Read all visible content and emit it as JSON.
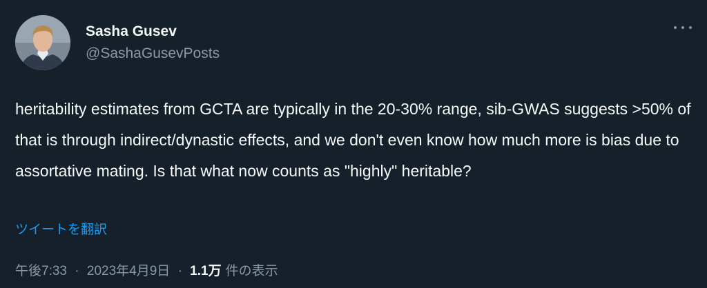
{
  "author": {
    "name": "Sasha Gusev",
    "handle": "@SashaGusevPosts"
  },
  "tweet": {
    "text": "heritability estimates from GCTA are typically in the 20-30% range, sib-GWAS suggests >50% of that is through indirect/dynastic effects, and we don't even know how much more is bias due to assortative mating. Is that what now counts as \"highly\" heritable?",
    "translate_label": "ツイートを翻訳"
  },
  "meta": {
    "time": "午後7:33",
    "date": "2023年4月9日",
    "separator": "·",
    "views_count": "1.1万",
    "views_label": "件の表示"
  },
  "icons": {
    "more": "more-horizontal-icon",
    "avatar": "profile-photo"
  },
  "colors": {
    "background": "#15202b",
    "primary_text": "#f7f9f9",
    "secondary_text": "#8b98a5",
    "link": "#1d9bf0"
  }
}
